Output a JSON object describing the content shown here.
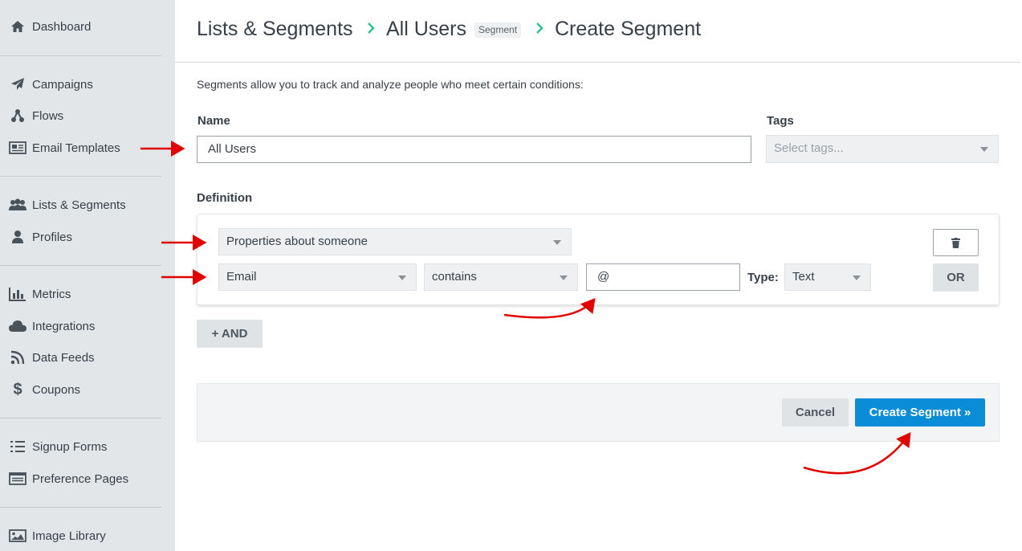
{
  "sidebar": {
    "items": [
      {
        "label": "Dashboard",
        "icon": "home-icon"
      },
      {
        "label": "Campaigns",
        "icon": "paper-plane-icon"
      },
      {
        "label": "Flows",
        "icon": "flows-icon"
      },
      {
        "label": "Email Templates",
        "icon": "newspaper-icon"
      },
      {
        "label": "Lists & Segments",
        "icon": "users-icon"
      },
      {
        "label": "Profiles",
        "icon": "user-icon"
      },
      {
        "label": "Metrics",
        "icon": "bar-chart-icon"
      },
      {
        "label": "Integrations",
        "icon": "cloud-icon"
      },
      {
        "label": "Data Feeds",
        "icon": "rss-icon"
      },
      {
        "label": "Coupons",
        "icon": "dollar-icon"
      },
      {
        "label": "Signup Forms",
        "icon": "list-icon"
      },
      {
        "label": "Preference Pages",
        "icon": "window-icon"
      },
      {
        "label": "Image Library",
        "icon": "image-icon"
      }
    ]
  },
  "header": {
    "breadcrumb": [
      "Lists & Segments",
      "All Users",
      "Create Segment"
    ],
    "badge": "Segment"
  },
  "form": {
    "description": "Segments allow you to track and analyze people who meet certain conditions:",
    "name_label": "Name",
    "name_value": "All Users",
    "tags_label": "Tags",
    "tags_placeholder": "Select tags...",
    "definition_label": "Definition"
  },
  "definition": {
    "condition_type": "Properties about someone",
    "property": "Email",
    "operator": "contains",
    "value": "@",
    "type_label": "Type:",
    "type_value": "Text",
    "or_label": "OR",
    "and_label": "+ AND"
  },
  "footer": {
    "cancel_label": "Cancel",
    "create_label": "Create Segment »"
  },
  "colors": {
    "sidebar_bg": "#e3e6e8",
    "primary": "#0a8dd6",
    "breadcrumb_chevron": "#2fbf8f",
    "annotation_arrow": "#e00000"
  }
}
